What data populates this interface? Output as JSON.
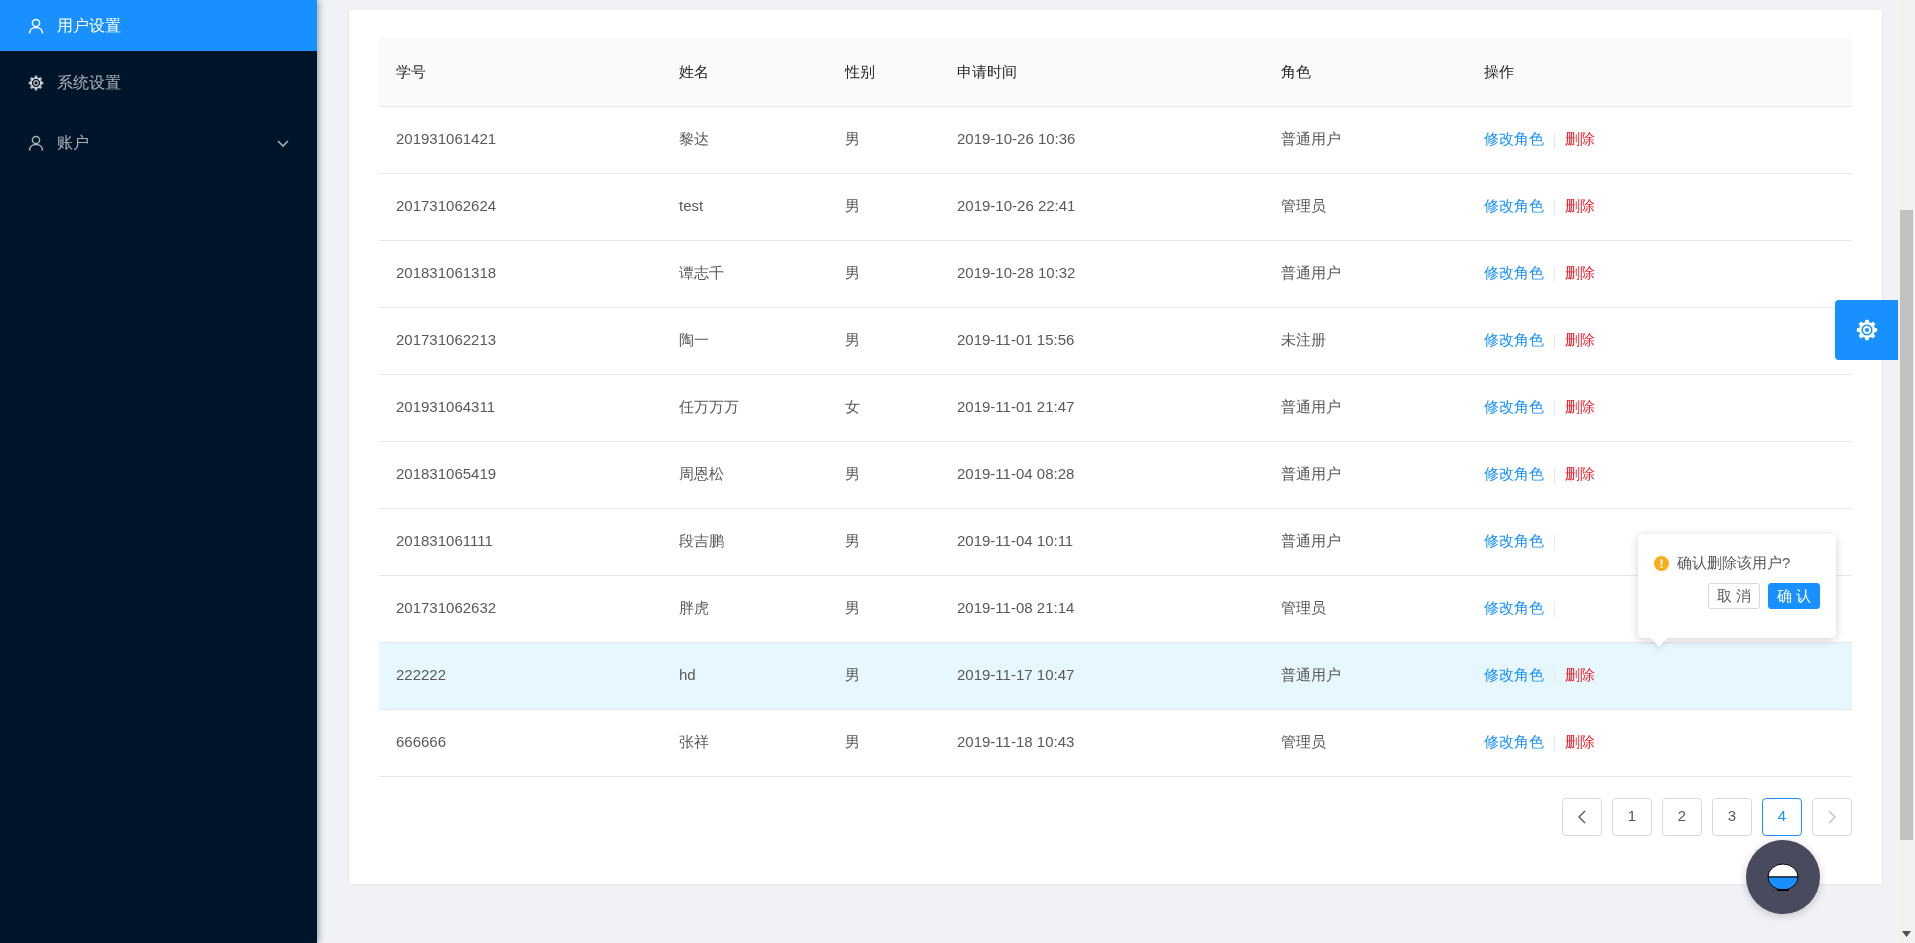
{
  "sidebar": {
    "items": [
      {
        "label": "用户设置",
        "kind": "user",
        "selected": true
      },
      {
        "label": "系统设置",
        "kind": "settings",
        "selected": false
      },
      {
        "label": "账户",
        "kind": "user",
        "selected": false,
        "submenu": {
          "expanded": false
        }
      }
    ]
  },
  "table": {
    "columns": [
      "学号",
      "姓名",
      "性别",
      "申请时间",
      "角色",
      "操作"
    ],
    "rows": [
      {
        "cells": [
          "201931061421",
          "黎达",
          "男",
          "2019-10-26 10:36",
          "普通用户"
        ],
        "selected": false,
        "actions": [
          {
            "label": "修改角色",
            "kind": "edit"
          },
          {
            "label": "删除",
            "kind": "delete"
          }
        ]
      },
      {
        "cells": [
          "201731062624",
          "test",
          "男",
          "2019-10-26 22:41",
          "管理员"
        ],
        "selected": false,
        "actions": [
          {
            "label": "修改角色",
            "kind": "edit"
          },
          {
            "label": "删除",
            "kind": "delete"
          }
        ]
      },
      {
        "cells": [
          "201831061318",
          "谭志千",
          "男",
          "2019-10-28 10:32",
          "普通用户"
        ],
        "selected": false,
        "actions": [
          {
            "label": "修改角色",
            "kind": "edit"
          },
          {
            "label": "删除",
            "kind": "delete"
          }
        ]
      },
      {
        "cells": [
          "201731062213",
          "陶一",
          "男",
          "2019-11-01 15:56",
          "未注册"
        ],
        "selected": false,
        "actions": [
          {
            "label": "修改角色",
            "kind": "edit"
          },
          {
            "label": "删除",
            "kind": "delete"
          }
        ]
      },
      {
        "cells": [
          "201931064311",
          "任万万万",
          "女",
          "2019-11-01 21:47",
          "普通用户"
        ],
        "selected": false,
        "actions": [
          {
            "label": "修改角色",
            "kind": "edit"
          },
          {
            "label": "删除",
            "kind": "delete"
          }
        ]
      },
      {
        "cells": [
          "201831065419",
          "周恩松",
          "男",
          "2019-11-04 08:28",
          "普通用户"
        ],
        "selected": false,
        "actions": [
          {
            "label": "修改角色",
            "kind": "edit"
          },
          {
            "label": "删除",
            "kind": "delete"
          }
        ]
      },
      {
        "cells": [
          "201831061111",
          "段吉鹏",
          "男",
          "2019-11-04 10:11",
          "普通用户"
        ],
        "selected": false,
        "actions": [
          {
            "label": "修改角色",
            "kind": "edit"
          }
        ]
      },
      {
        "cells": [
          "201731062632",
          "胖虎",
          "男",
          "2019-11-08 21:14",
          "管理员"
        ],
        "selected": false,
        "actions": [
          {
            "label": "修改角色",
            "kind": "edit"
          }
        ]
      },
      {
        "cells": [
          "222222",
          "hd",
          "男",
          "2019-11-17 10:47",
          "普通用户"
        ],
        "selected": true,
        "actions": [
          {
            "label": "修改角色",
            "kind": "edit"
          },
          {
            "label": "删除",
            "kind": "delete"
          }
        ]
      },
      {
        "cells": [
          "666666",
          "张祥",
          "男",
          "2019-11-18 10:43",
          "管理员"
        ],
        "selected": false,
        "actions": [
          {
            "label": "修改角色",
            "kind": "edit"
          },
          {
            "label": "删除",
            "kind": "delete"
          }
        ]
      }
    ]
  },
  "popconfirm": {
    "message": "确认删除该用户?",
    "buttons": [
      {
        "label": "取 消",
        "kind": "default"
      },
      {
        "label": "确 认",
        "kind": "primary"
      }
    ]
  },
  "pagination": [
    {
      "kind": "prev",
      "disabled": false
    },
    {
      "kind": "page",
      "label": "1",
      "selected": false
    },
    {
      "kind": "page",
      "label": "2",
      "selected": false
    },
    {
      "kind": "page",
      "label": "3",
      "selected": false
    },
    {
      "kind": "page",
      "label": "4",
      "selected": true
    },
    {
      "kind": "next",
      "disabled": true
    }
  ]
}
